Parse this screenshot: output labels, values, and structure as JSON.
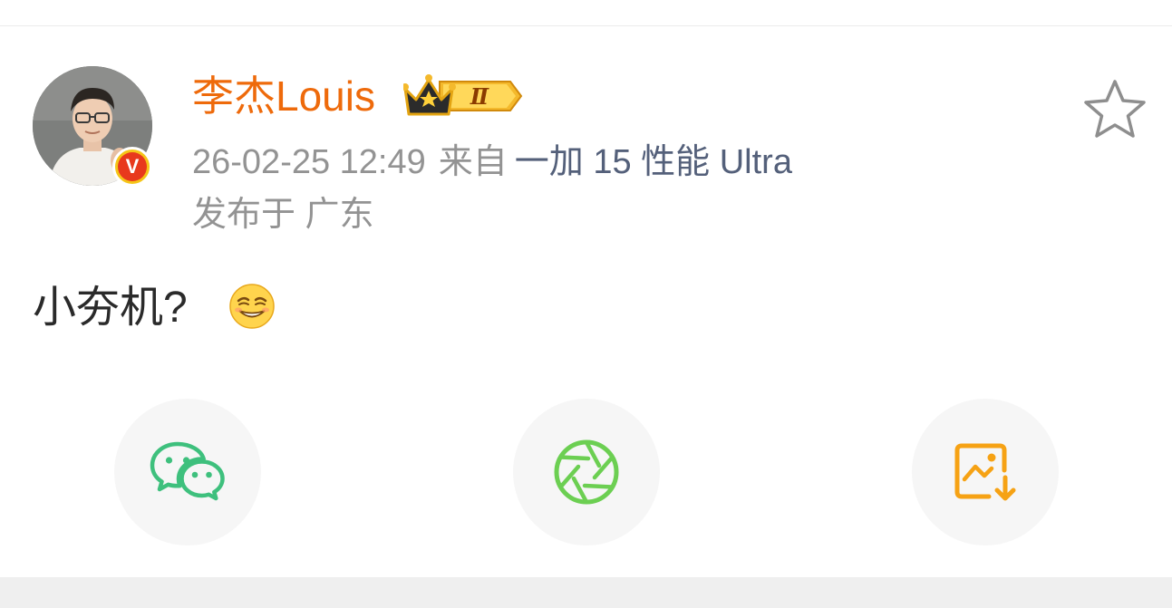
{
  "post": {
    "author": {
      "name": "李杰Louis",
      "verified_badge": "V",
      "vip_level": "Ⅱ",
      "avatar_icon": "avatar-photo"
    },
    "timestamp": "26-02-25 12:49",
    "from_label": "来自",
    "device": "一加 15 性能 Ultra",
    "location": "发布于 广东",
    "content": "小夯机?",
    "content_emoji": "smirk-emoji",
    "favorite_icon": "star-outline-icon"
  },
  "share_actions": [
    {
      "icon": "wechat-icon",
      "color": "#3ec07d"
    },
    {
      "icon": "moments-icon",
      "color": "#6ccf52"
    },
    {
      "icon": "save-image-icon",
      "color": "#f6a214"
    }
  ],
  "colors": {
    "username": "#ee6a0b",
    "meta_gray": "#939393",
    "device_link": "#54607a",
    "text": "#2a2a2a"
  }
}
